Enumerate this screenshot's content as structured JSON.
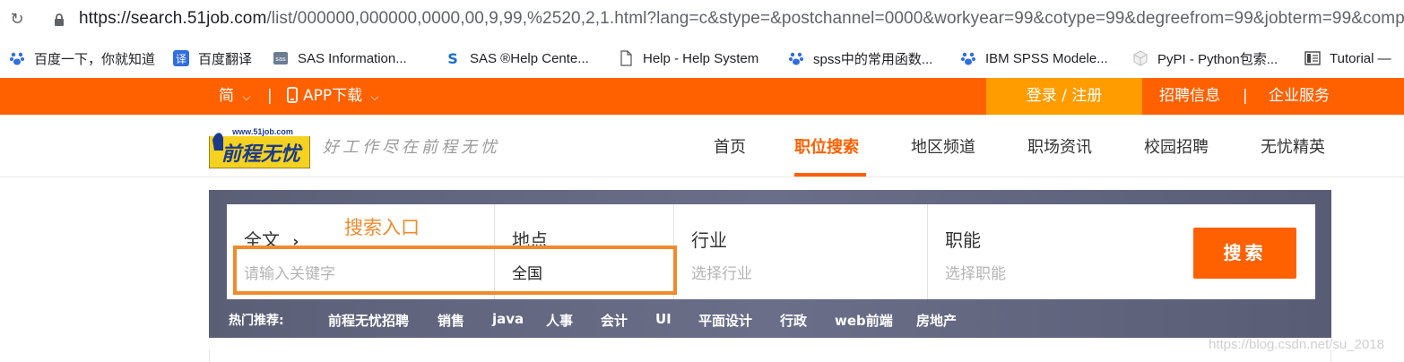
{
  "browser": {
    "url_main": "https://search.51job.com",
    "url_rest": "/list/000000,000000,0000,00,9,99,%2520,2,1.html?lang=c&stype=&postchannel=0000&workyear=99&cotype=99&degreefrom=99&jobterm=99&comp",
    "reload_icon": "reload-icon",
    "lock_icon": "lock-icon"
  },
  "bookmarks": [
    {
      "label": "百度一下，你就知道",
      "icon": "paw-icon"
    },
    {
      "label": "百度翻译",
      "icon": "translate-icon"
    },
    {
      "label": "SAS Information...",
      "icon": "sas-icon"
    },
    {
      "label": "SAS ®Help Cente...",
      "icon": "s-icon"
    },
    {
      "label": "Help - Help System",
      "icon": "page-icon"
    },
    {
      "label": "spss中的常用函数...",
      "icon": "paw-icon"
    },
    {
      "label": "IBM SPSS Modele...",
      "icon": "paw-icon"
    },
    {
      "label": "PyPI - Python包索...",
      "icon": "cube-icon"
    },
    {
      "label": "Tutorial —",
      "icon": "book-icon"
    }
  ],
  "topbar": {
    "lang": "简",
    "app": "APP下载",
    "login": "登录 / 注册",
    "jobs_info": "招聘信息",
    "sep": "|",
    "enterprise": "企业服务"
  },
  "header": {
    "logo_url_text": "www.51job.com",
    "logo_text": "前程无忧",
    "slogan": "好工作尽在前程无忧",
    "nav": [
      "首页",
      "职位搜索",
      "地区频道",
      "职场资讯",
      "校园招聘",
      "无忧精英"
    ]
  },
  "search": {
    "fulltext_label": "全文",
    "keyword_placeholder": "请输入关键字",
    "location_label": "地点",
    "location_value": "全国",
    "industry_label": "行业",
    "industry_placeholder": "选择行业",
    "function_label": "职能",
    "function_placeholder": "选择职能",
    "button": "搜索",
    "annotation": "搜索入口"
  },
  "hot": {
    "label": "热门推荐:",
    "items": [
      "前程无忧招聘",
      "销售",
      "java",
      "人事",
      "会计",
      "UI",
      "平面设计",
      "行政",
      "web前端",
      "房地产"
    ]
  },
  "watermark": "https://blog.csdn.net/su_2018",
  "colors": {
    "brand_orange": "#ff6000",
    "login_orange": "#ff9c00",
    "annotation": "#f08a2c",
    "panel": "#62667f"
  }
}
